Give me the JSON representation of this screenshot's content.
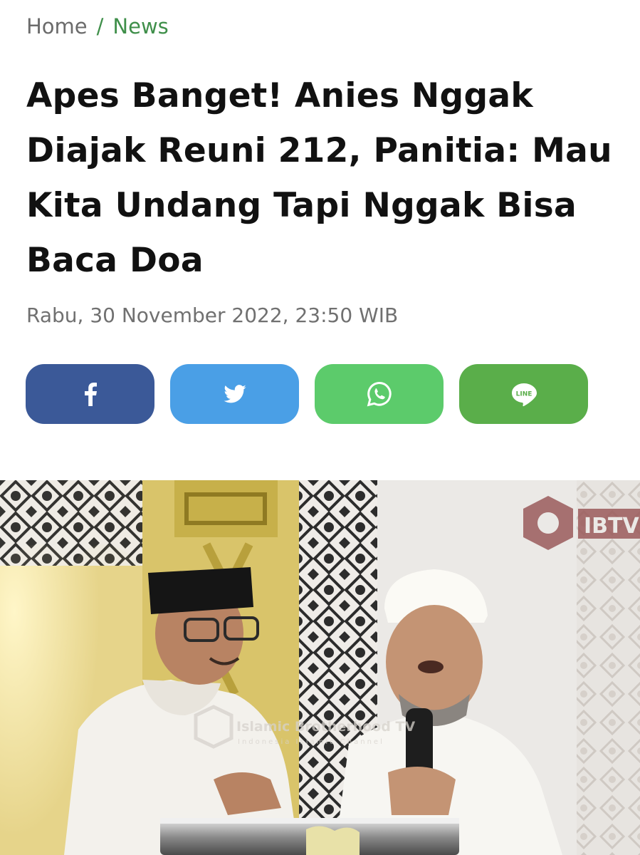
{
  "breadcrumb": {
    "home": "Home",
    "separator": "/",
    "current": "News"
  },
  "article": {
    "title": "Apes Banget! Anies Nggak Diajak Reuni 212, Panitia: Mau Kita Undang Tapi Nggak Bisa Baca Doa",
    "date": "Rabu, 30 November 2022, 23:50 WIB"
  },
  "share": {
    "buttons": [
      {
        "network": "facebook",
        "icon": "facebook-icon",
        "color": "#3b5998"
      },
      {
        "network": "twitter",
        "icon": "twitter-icon",
        "color": "#4a9fe6"
      },
      {
        "network": "whatsapp",
        "icon": "whatsapp-icon",
        "color": "#5ccb6b"
      },
      {
        "network": "line",
        "icon": "line-icon",
        "color": "#5aae4a",
        "label": "LINE"
      }
    ]
  },
  "photo": {
    "channel_logo": "IBTV",
    "watermark_title": "Islamic Brotherhood TV",
    "watermark_subtitle": "Indonesia Islamic Channel"
  },
  "colors": {
    "accent": "#3f8f4a",
    "text": "#111111",
    "muted": "#707070"
  }
}
